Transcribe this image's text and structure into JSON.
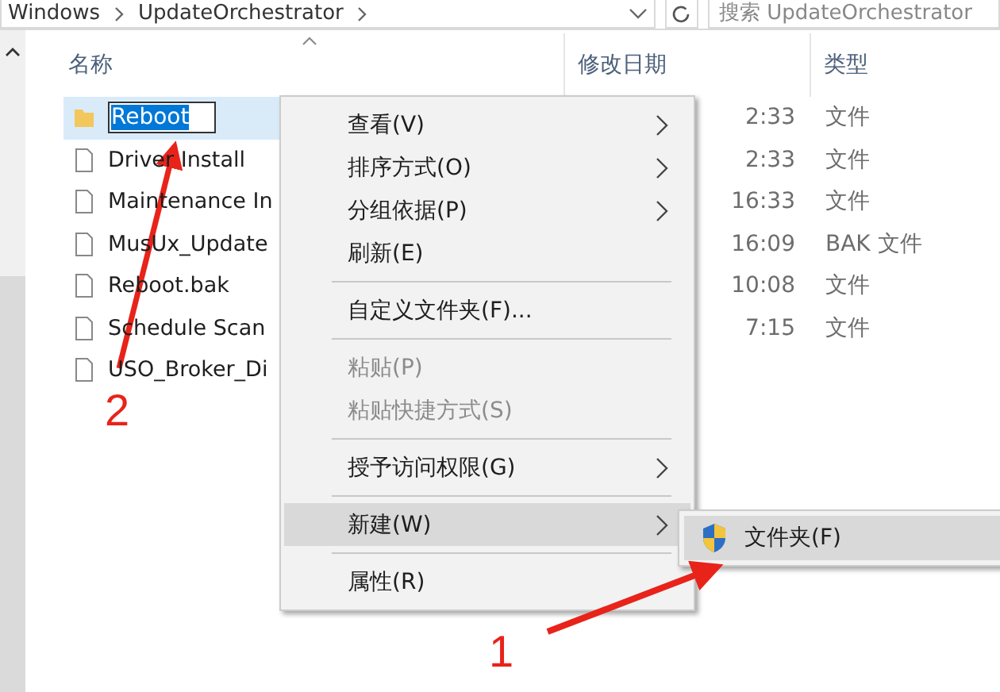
{
  "address_bar": {
    "path": [
      "Windows",
      "UpdateOrchestrator"
    ],
    "search_placeholder": "搜索 UpdateOrchestrator"
  },
  "columns": [
    {
      "label": "名称",
      "sorted": true
    },
    {
      "label": "修改日期",
      "sorted": false
    },
    {
      "label": "类型",
      "sorted": false
    }
  ],
  "rows": [
    {
      "name": "Reboot",
      "kind": "folder",
      "editing": true,
      "selected": true,
      "date": "2:33",
      "type": "文件"
    },
    {
      "name": "Driver Install",
      "kind": "file",
      "editing": false,
      "selected": false,
      "date": "2:33",
      "type": "文件"
    },
    {
      "name": "Maintenance In",
      "kind": "file",
      "editing": false,
      "selected": false,
      "date": "16:33",
      "type": "文件"
    },
    {
      "name": "MusUx_Update",
      "kind": "file",
      "editing": false,
      "selected": false,
      "date": "16:09",
      "type": "BAK 文件"
    },
    {
      "name": "Reboot.bak",
      "kind": "file",
      "editing": false,
      "selected": false,
      "date": "10:08",
      "type": "文件"
    },
    {
      "name": "Schedule Scan",
      "kind": "file",
      "editing": false,
      "selected": false,
      "date": "7:15",
      "type": "文件"
    },
    {
      "name": "USO_Broker_Di",
      "kind": "file",
      "editing": false,
      "selected": false
    }
  ],
  "context_menu": [
    {
      "kind": "item",
      "label": "查看(V)",
      "submenu": true,
      "disabled": false,
      "selected": false
    },
    {
      "kind": "item",
      "label": "排序方式(O)",
      "submenu": true,
      "disabled": false,
      "selected": false
    },
    {
      "kind": "item",
      "label": "分组依据(P)",
      "submenu": true,
      "disabled": false,
      "selected": false
    },
    {
      "kind": "item",
      "label": "刷新(E)",
      "submenu": false,
      "disabled": false,
      "selected": false
    },
    {
      "kind": "separator"
    },
    {
      "kind": "item",
      "label": "自定义文件夹(F)...",
      "submenu": false,
      "disabled": false,
      "selected": false
    },
    {
      "kind": "separator"
    },
    {
      "kind": "item",
      "label": "粘贴(P)",
      "submenu": false,
      "disabled": true,
      "selected": false
    },
    {
      "kind": "item",
      "label": "粘贴快捷方式(S)",
      "submenu": false,
      "disabled": true,
      "selected": false
    },
    {
      "kind": "separator"
    },
    {
      "kind": "item",
      "label": "授予访问权限(G)",
      "submenu": true,
      "disabled": false,
      "selected": false
    },
    {
      "kind": "separator"
    },
    {
      "kind": "item",
      "label": "新建(W)",
      "submenu": true,
      "disabled": false,
      "selected": true
    },
    {
      "kind": "separator"
    },
    {
      "kind": "item",
      "label": "属性(R)",
      "submenu": false,
      "disabled": false,
      "selected": false
    }
  ],
  "submenu": [
    {
      "label": "文件夹(F)",
      "selected": true
    }
  ],
  "annotations": [
    {
      "label": "1"
    },
    {
      "label": "2"
    }
  ]
}
